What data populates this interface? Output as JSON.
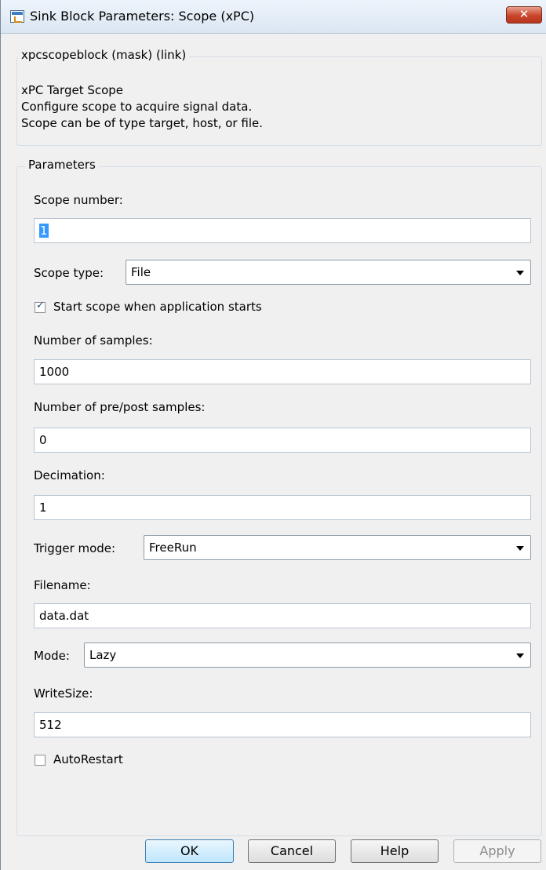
{
  "window": {
    "title": "Sink Block Parameters: Scope (xPC)",
    "close_glyph": "✕"
  },
  "description_group": {
    "legend": "xpcscopeblock (mask) (link)",
    "lines": [
      "xPC Target Scope",
      "Configure scope to acquire signal data.",
      "Scope can be of type target, host, or file."
    ]
  },
  "parameters_group": {
    "legend": "Parameters",
    "scope_number": {
      "label": "Scope number:",
      "value": "1"
    },
    "scope_type": {
      "label": "Scope type:",
      "value": "File"
    },
    "start_scope": {
      "label": "Start scope when application starts",
      "checked": true
    },
    "num_samples": {
      "label": "Number of samples:",
      "value": "1000"
    },
    "pre_post": {
      "label": "Number of pre/post samples:",
      "value": "0"
    },
    "decimation": {
      "label": "Decimation:",
      "value": "1"
    },
    "trigger_mode": {
      "label": "Trigger mode:",
      "value": "FreeRun"
    },
    "filename": {
      "label": "Filename:",
      "value": "data.dat"
    },
    "mode": {
      "label": "Mode:",
      "value": "Lazy"
    },
    "write_size": {
      "label": "WriteSize:",
      "value": "512"
    },
    "auto_restart": {
      "label": "AutoRestart",
      "checked": false
    }
  },
  "buttons": {
    "ok": "OK",
    "cancel": "Cancel",
    "help": "Help",
    "apply": "Apply"
  }
}
